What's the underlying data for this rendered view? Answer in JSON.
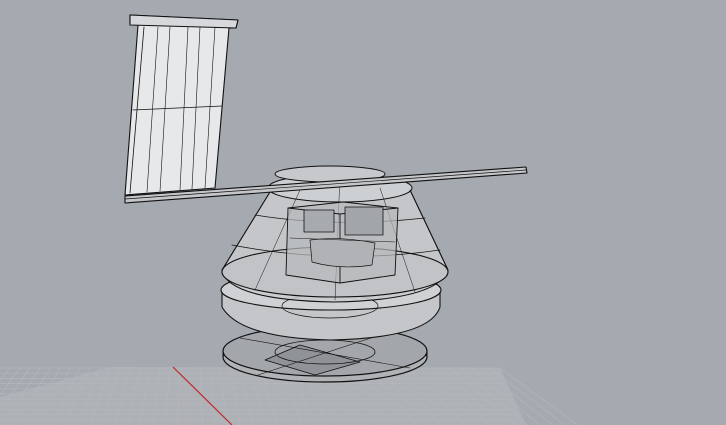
{
  "viewport": {
    "background_color": "#a5a9b0",
    "grid_color": "#b4b7bc",
    "x_axis_color": "#c0282a",
    "model_line_color": "#111111",
    "panel_fill_color": "#eef0f2",
    "shell_fill_color": "#c9cbce"
  },
  "icons": {
    "model": "wireframe-3d-model",
    "grid": "construction-grid-plane"
  }
}
